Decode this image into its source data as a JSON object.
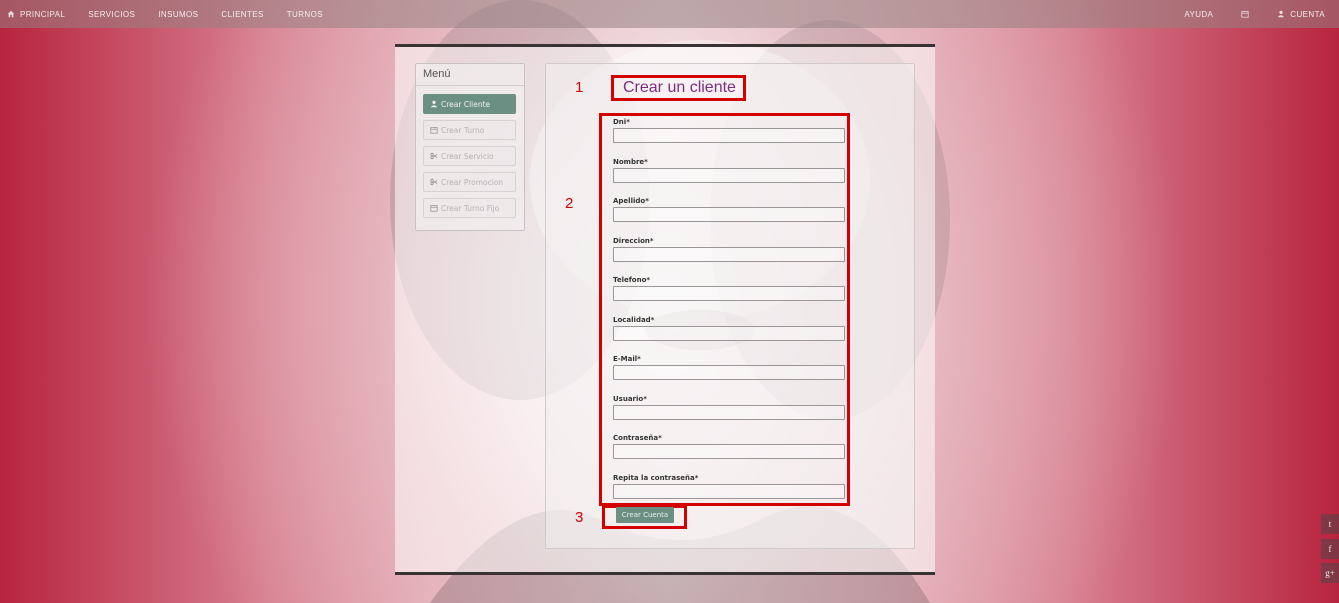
{
  "nav": {
    "left": [
      {
        "label": "PRINCIPAL",
        "icon": "home-icon"
      },
      {
        "label": "SERVICIOS"
      },
      {
        "label": "INSUMOS"
      },
      {
        "label": "CLIENTES"
      },
      {
        "label": "TURNOS"
      }
    ],
    "right": {
      "help": "AYUDA",
      "calendar_icon": "calendar-icon",
      "account": "CUENTA",
      "account_icon": "user-icon"
    }
  },
  "menu": {
    "title": "Menú",
    "items": [
      {
        "label": "Crear Cliente",
        "icon": "user-icon",
        "active": true
      },
      {
        "label": "Crear Turno",
        "icon": "calendar-icon"
      },
      {
        "label": "Crear Servicio",
        "icon": "scissors-icon"
      },
      {
        "label": "Crear Promocion",
        "icon": "scissors-icon"
      },
      {
        "label": "Crear Turno Fijo",
        "icon": "calendar-icon"
      }
    ]
  },
  "form": {
    "title": "Crear un cliente",
    "fields": [
      {
        "label": "Dni*",
        "value": ""
      },
      {
        "label": "Nombre*",
        "value": ""
      },
      {
        "label": "Apellido*",
        "value": ""
      },
      {
        "label": "Direccion*",
        "value": ""
      },
      {
        "label": "Telefono*",
        "value": ""
      },
      {
        "label": "Localidad*",
        "value": ""
      },
      {
        "label": "E-Mail*",
        "value": ""
      },
      {
        "label": "Usuario*",
        "value": ""
      },
      {
        "label": "Contraseña*",
        "value": ""
      },
      {
        "label": "Repita la contraseña*",
        "value": ""
      }
    ],
    "submit": "Crear Cuenta"
  },
  "annotations": {
    "m1": "1",
    "m2": "2",
    "m3": "3"
  },
  "social": [
    {
      "glyph": "t",
      "icon": "twitter-icon"
    },
    {
      "glyph": "f",
      "icon": "facebook-icon"
    },
    {
      "glyph": "g+",
      "icon": "google-plus-icon"
    }
  ],
  "colors": {
    "accent": "#6b8f83",
    "title": "#7e2e7c",
    "annotation": "#d40000"
  }
}
